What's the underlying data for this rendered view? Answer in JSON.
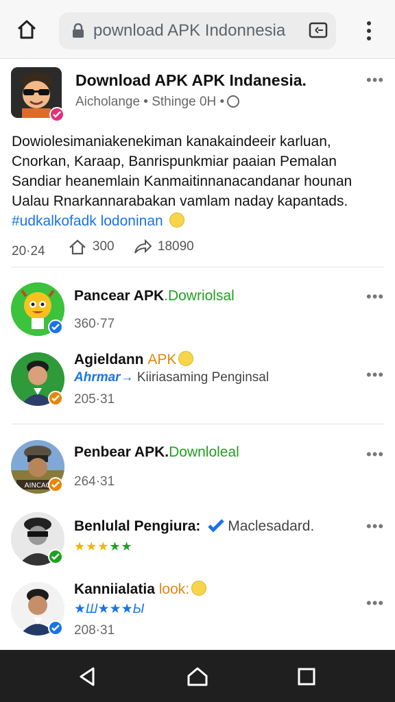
{
  "browser": {
    "url": "pownload APK Indonnesia"
  },
  "post": {
    "title": "Download APK APK Indanesia.",
    "meta": "Aicholange • Sthinge 0H •",
    "body": "Dowiolesimaniakenekiman kanakaindeeir karluan, Cnorkan, Karaap, Banrispunkmiar paaian Pemalan Sandiar heanemlain Kanmaitinnanacandanar hounan Ualau Rnarkannarabakan vamlam naday kapantads.",
    "hashtag": "#udkalkofadk lodoninan",
    "stats": {
      "likes": "20·24",
      "shares": "300",
      "forwards": "18090"
    }
  },
  "items": [
    {
      "name": "Pancear APK",
      "name_accent": ".Dowriolsal",
      "sub": "360·77"
    },
    {
      "name": "Agieldann",
      "name_accent": "APK",
      "link": "Ahrmar→",
      "link_rest": "Kiiriasaming Penginsal",
      "sub": "205·31"
    },
    {
      "name": "Penbear APK.",
      "name_accent": "Downloleal",
      "sub": "264·31"
    },
    {
      "name": "Benlulal Pengiura:",
      "name_accent": "Maclesadard.",
      "stars": "★★★",
      "stars_green": "★★"
    },
    {
      "name": "Kanniialatia",
      "name_accent": "look:",
      "stars_blue": "★Ш★★★Ы",
      "sub": "208·31"
    }
  ],
  "colors": {
    "accent_green": "#1fa11f",
    "accent_blue": "#1a73e8",
    "accent_orange": "#e8850c",
    "navbar": "#1f1f1f"
  }
}
